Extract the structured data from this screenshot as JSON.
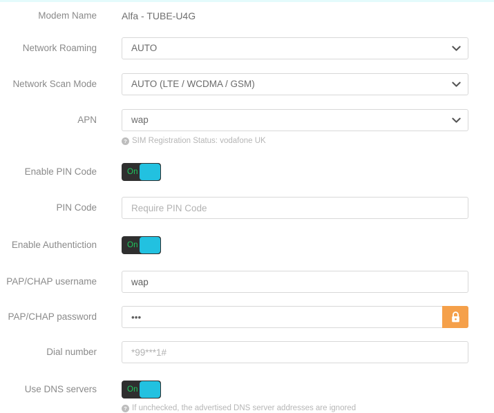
{
  "theme": {
    "accent_cyan": "#22c1e0",
    "top_bar": "#e4fbfc",
    "toggle_off_track": "#2f2f2f",
    "toggle_on_text": "#1fc95f",
    "lock_button": "#f5a04a",
    "label_color": "#8a8a8a",
    "placeholder_color": "#b2b2b2"
  },
  "form": {
    "modem_name": {
      "label": "Modem Name",
      "value": "Alfa - TUBE-U4G"
    },
    "network_roaming": {
      "label": "Network Roaming",
      "value": "AUTO",
      "icon": "chevron-down-icon"
    },
    "network_scan_mode": {
      "label": "Network Scan Mode",
      "value": "AUTO (LTE / WCDMA / GSM)",
      "icon": "chevron-down-icon"
    },
    "apn": {
      "label": "APN",
      "value": "wap",
      "icon": "chevron-down-icon",
      "hint": "SIM Registration Status: vodafone UK",
      "hint_icon": "help-circle-icon"
    },
    "enable_pin_code": {
      "label": "Enable PIN Code",
      "state": "On"
    },
    "pin_code": {
      "label": "PIN Code",
      "value": "",
      "placeholder": "Require PIN Code"
    },
    "enable_authentication": {
      "label": "Enable Authentiction",
      "state": "On"
    },
    "pap_chap_username": {
      "label": "PAP/CHAP username",
      "value": "wap",
      "placeholder": ""
    },
    "pap_chap_password": {
      "label": "PAP/CHAP password",
      "value": "•••",
      "placeholder": "",
      "lock_icon": "lock-icon"
    },
    "dial_number": {
      "label": "Dial number",
      "value": "",
      "placeholder": "*99***1#"
    },
    "use_dns_servers": {
      "label": "Use DNS servers",
      "state": "On",
      "hint": "If unchecked, the advertised DNS server addresses are ignored",
      "hint_icon": "help-circle-icon"
    }
  }
}
